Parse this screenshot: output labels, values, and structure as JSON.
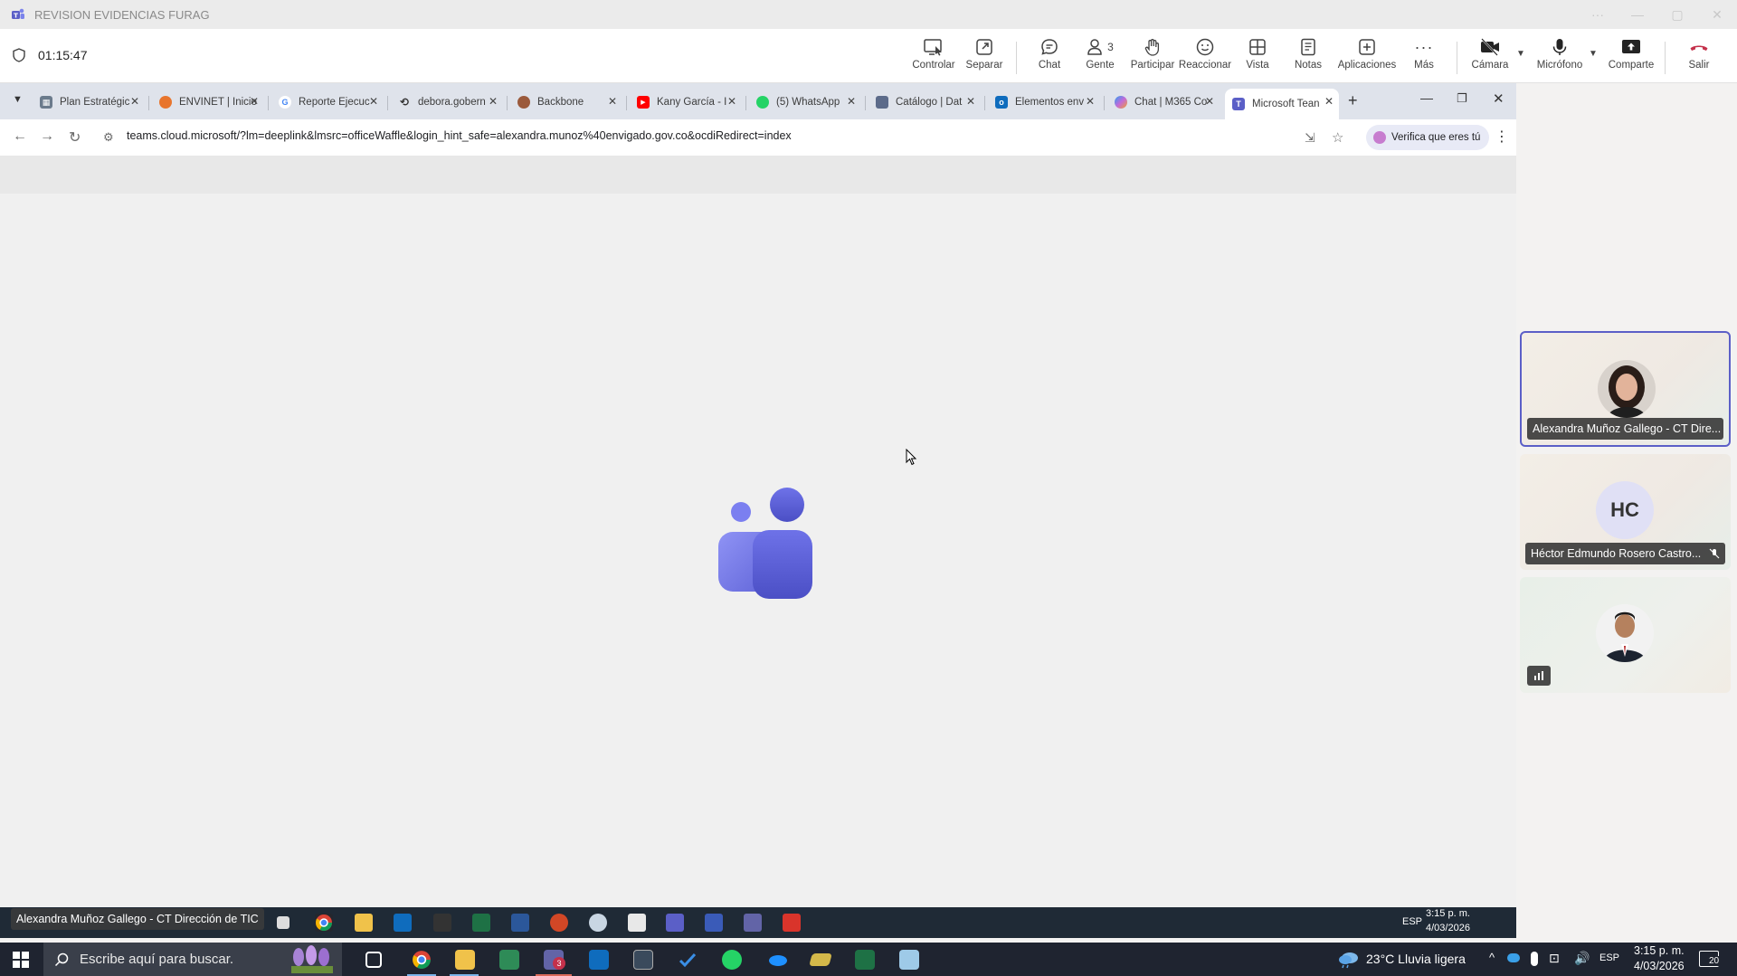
{
  "window": {
    "title": "REVISION EVIDENCIAS FURAG"
  },
  "meeting": {
    "timer": "01:15:47",
    "controls": [
      {
        "label": "Controlar",
        "icon": "control-icon"
      },
      {
        "label": "Separar",
        "icon": "popout-icon"
      },
      {
        "label": "Chat",
        "icon": "chat-icon"
      },
      {
        "label": "Gente",
        "icon": "people-icon",
        "count": "3"
      },
      {
        "label": "Participar",
        "icon": "raise-hand-icon"
      },
      {
        "label": "Reaccionar",
        "icon": "emoji-icon"
      },
      {
        "label": "Vista",
        "icon": "view-icon"
      },
      {
        "label": "Notas",
        "icon": "notes-icon"
      },
      {
        "label": "Aplicaciones",
        "icon": "apps-icon"
      },
      {
        "label": "Más",
        "icon": "more-icon"
      },
      {
        "label": "Cámara",
        "icon": "camera-off-icon"
      },
      {
        "label": "Micrófono",
        "icon": "mic-icon"
      },
      {
        "label": "Comparte",
        "icon": "share-icon"
      },
      {
        "label": "Salir",
        "icon": "hangup-icon"
      }
    ]
  },
  "browser": {
    "tabs": [
      {
        "title": "Plan Estratégic",
        "icon": "plan-icon"
      },
      {
        "title": "ENVINET | Inicio",
        "icon": "envinet-icon"
      },
      {
        "title": "Reporte Ejecuc",
        "icon": "google-icon"
      },
      {
        "title": "debora.gobern",
        "icon": "link-icon"
      },
      {
        "title": "Backbone",
        "icon": "backbone-icon"
      },
      {
        "title": "Kany García - I",
        "icon": "youtube-icon"
      },
      {
        "title": "(5) WhatsApp",
        "icon": "whatsapp-icon"
      },
      {
        "title": "Catálogo | Dat",
        "icon": "catalog-icon"
      },
      {
        "title": "Elementos env",
        "icon": "outlook-icon"
      },
      {
        "title": "Chat | M365 Co",
        "icon": "copilot-icon"
      },
      {
        "title": "Microsoft Tean",
        "icon": "teams-icon",
        "active": true
      }
    ],
    "url": "teams.cloud.microsoft/?lm=deeplink&lmsrc=officeWaffle&login_hint_safe=alexandra.munoz%40envigado.gov.co&ocdiRedirect=index",
    "verify_label": "Verifica que eres tú"
  },
  "shared_screen": {
    "presenter_tag": "Alexandra Muñoz Gallego - CT Dirección de TIC",
    "tray": {
      "lang": "ESP",
      "time": "3:15 p. m.",
      "date": "4/03/2026"
    }
  },
  "participants": [
    {
      "name": "Alexandra Muñoz Gallego - CT Dire...",
      "active": true
    },
    {
      "name": "Héctor Edmundo Rosero Castro...",
      "initials": "HC",
      "muted": true
    },
    {
      "name": ""
    }
  ],
  "taskbar": {
    "search_placeholder": "Escribe aquí para buscar.",
    "weather": "23°C  Lluvia ligera",
    "lang": "ESP",
    "time": "3:15 p. m.",
    "date": "4/03/2026",
    "notifications": "20",
    "teams_badge": "3"
  },
  "colors": {
    "accent": "#5b5fc7",
    "teams_purple": "#6264a7",
    "hangup": "#c4314b"
  }
}
